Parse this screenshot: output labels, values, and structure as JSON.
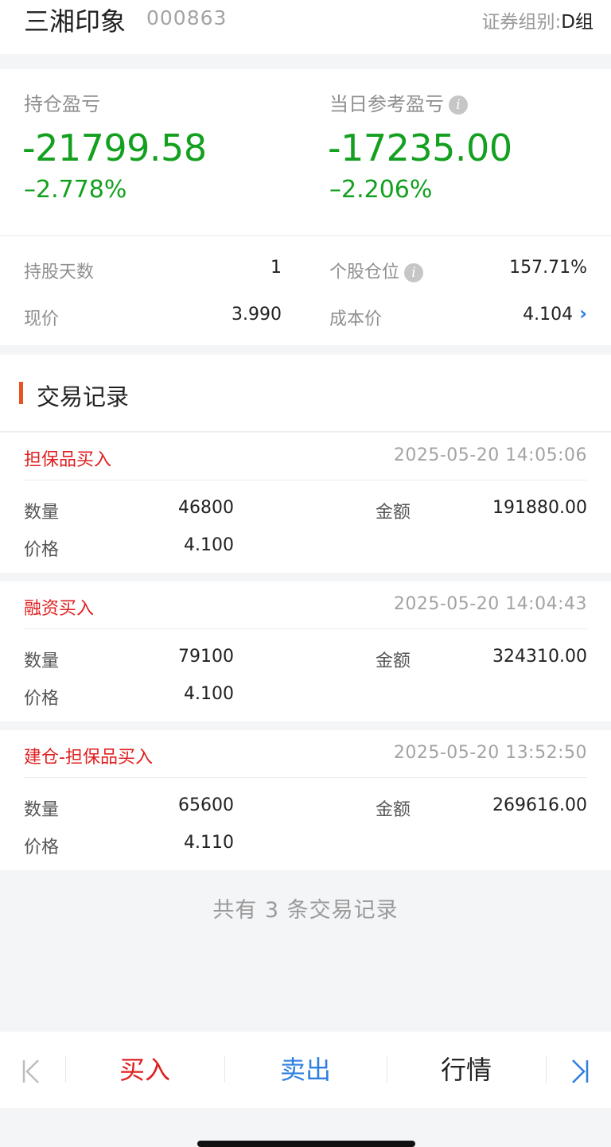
{
  "header": {
    "stock_name": "三湘印象",
    "stock_code": "000863",
    "group_label": "证券组别:",
    "group_value": "D组"
  },
  "summary": {
    "position_pl_title": "持仓盈亏",
    "position_pl_value": "-21799.58",
    "position_pl_pct": "–2.778%",
    "daily_pl_title": "当日参考盈亏",
    "daily_pl_value": "-17235.00",
    "daily_pl_pct": "–2.206%",
    "hold_days_label": "持股天数",
    "hold_days_value": "1",
    "position_ratio_label": "个股仓位",
    "position_ratio_value": "157.71%",
    "price_label": "现价",
    "price_value": "3.990",
    "cost_label": "成本价",
    "cost_value": "4.104",
    "info_icon": "i",
    "chevron": "›"
  },
  "records_title": "交易记录",
  "records": [
    {
      "type": "担保品买入",
      "time": "2025-05-20 14:05:06",
      "qty_label": "数量",
      "qty": "46800",
      "amount_label": "金额",
      "amount": "191880.00",
      "price_label": "价格",
      "price": "4.100"
    },
    {
      "type": "融资买入",
      "time": "2025-05-20 14:04:43",
      "qty_label": "数量",
      "qty": "79100",
      "amount_label": "金额",
      "amount": "324310.00",
      "price_label": "价格",
      "price": "4.100"
    },
    {
      "type": "建仓-担保品买入",
      "time": "2025-05-20 13:52:50",
      "qty_label": "数量",
      "qty": "65600",
      "amount_label": "金额",
      "amount": "269616.00",
      "price_label": "价格",
      "price": "4.110"
    }
  ],
  "footer_note": "共有 3 条交易记录",
  "bottom_nav": {
    "first_icon": "|<",
    "buy_label": "买入",
    "sell_label": "卖出",
    "quote_label": "行情",
    "last_icon": ">|"
  },
  "colors": {
    "loss_green": "#13a01f",
    "trade_red": "#e02020",
    "accent_orange": "#e8541f",
    "link_blue": "#2f7fe0"
  }
}
